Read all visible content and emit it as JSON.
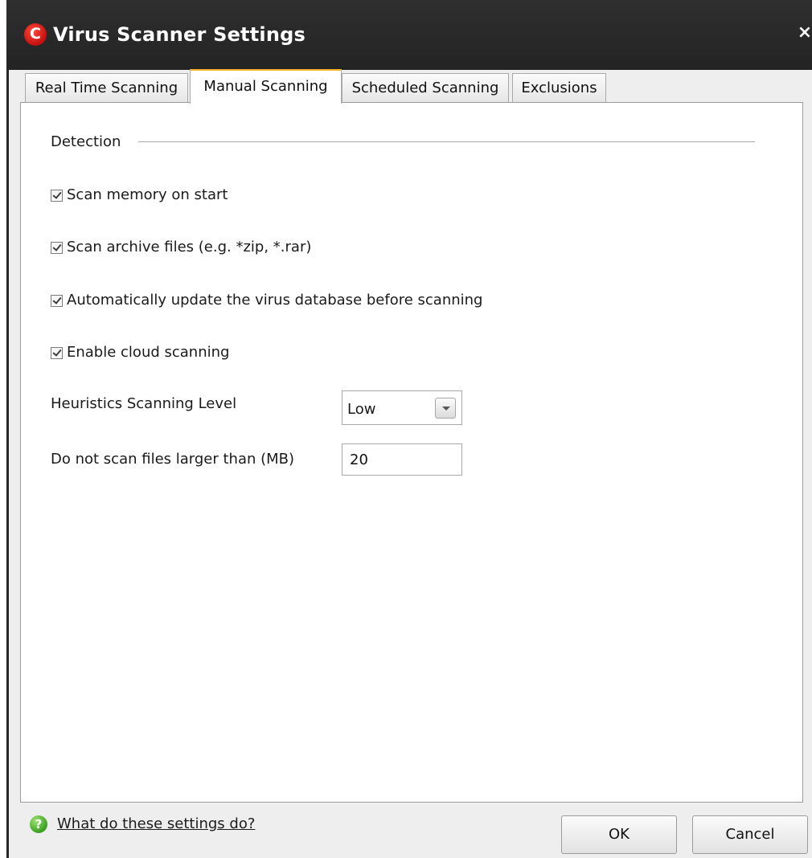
{
  "window": {
    "logo_letter": "C",
    "title": "Virus Scanner Settings",
    "close_glyph": "×",
    "colors": {
      "titlebar": "#262626",
      "logo": "#d41a14",
      "active_tab_accent": "#f5b42a",
      "help_icon": "#4aa82a"
    }
  },
  "tabs": [
    {
      "label": "Real Time Scanning",
      "active": false
    },
    {
      "label": "Manual Scanning",
      "active": true
    },
    {
      "label": "Scheduled Scanning",
      "active": false
    },
    {
      "label": "Exclusions",
      "active": false
    }
  ],
  "detection": {
    "section_label": "Detection",
    "options": [
      {
        "label": "Scan memory on start",
        "checked": true
      },
      {
        "label": "Scan archive files (e.g. *zip, *.rar)",
        "checked": true
      },
      {
        "label": "Automatically update the virus database before scanning",
        "checked": true
      },
      {
        "label": "Enable cloud scanning",
        "checked": true
      }
    ],
    "heuristics": {
      "label": "Heuristics Scanning Level",
      "value": "Low"
    },
    "max_size": {
      "label": "Do not scan files larger than (MB)",
      "value": "20"
    }
  },
  "footer": {
    "help_icon": "question-icon",
    "help_icon_glyph": "?",
    "help_link": "What do these settings do?",
    "ok_label": "OK",
    "cancel_label": "Cancel"
  }
}
